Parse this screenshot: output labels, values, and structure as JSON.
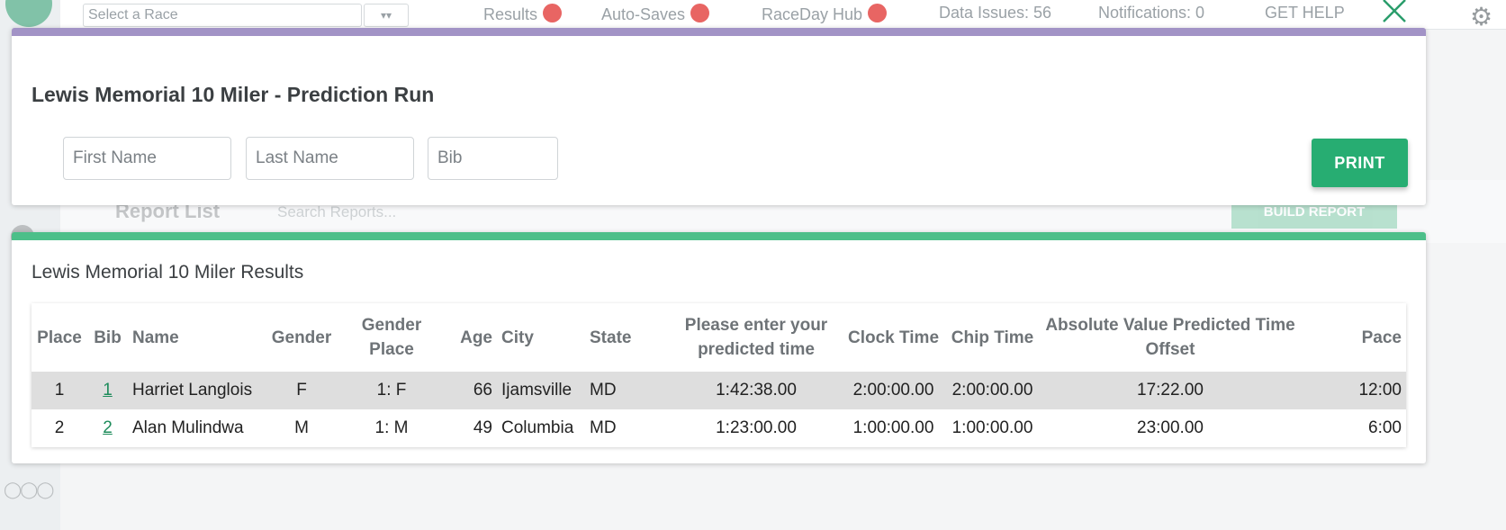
{
  "background": {
    "race_select_placeholder": "Select a Race",
    "nav": [
      {
        "label": "Results",
        "has_dot": true
      },
      {
        "label": "Auto-Saves",
        "has_dot": true
      },
      {
        "label": "RaceDay Hub",
        "has_dot": true
      },
      {
        "label": "Data Issues: 56",
        "has_dot": false
      },
      {
        "label": "Notifications: 0",
        "has_dot": false
      },
      {
        "label": "GET HELP",
        "has_dot": false
      }
    ],
    "report_list_title": "Report List",
    "report_search_placeholder": "Search Reports...",
    "build_report_label": "BUILD REPORT"
  },
  "modal": {
    "close_icon": "close-icon",
    "search_card": {
      "title": "Lewis Memorial 10 Miler - Prediction Run",
      "first_name_placeholder": "First Name",
      "last_name_placeholder": "Last Name",
      "bib_placeholder": "Bib",
      "print_label": "PRINT",
      "accent_color": "#a293c6"
    },
    "results_card": {
      "title": "Lewis Memorial 10 Miler Results",
      "accent_color": "#4cbf89",
      "columns": [
        "Place",
        "Bib",
        "Name",
        "Gender",
        "Gender Place",
        "Age",
        "City",
        "State",
        "Please enter your predicted time",
        "Clock Time",
        "Chip Time",
        "Absolute Value Predicted Time Offset",
        "Pace"
      ],
      "rows": [
        {
          "place": "1",
          "bib": "1",
          "name": "Harriet Langlois",
          "gender": "F",
          "gender_place": "1: F",
          "age": "66",
          "city": "Ijamsville",
          "state": "MD",
          "predicted_time": "1:42:38.00",
          "clock_time": "2:00:00.00",
          "chip_time": "2:00:00.00",
          "offset": "17:22.00",
          "pace": "12:00"
        },
        {
          "place": "2",
          "bib": "2",
          "name": "Alan Mulindwa",
          "gender": "M",
          "gender_place": "1: M",
          "age": "49",
          "city": "Columbia",
          "state": "MD",
          "predicted_time": "1:23:00.00",
          "clock_time": "1:00:00.00",
          "chip_time": "1:00:00.00",
          "offset": "23:00.00",
          "pace": "6:00"
        }
      ]
    }
  },
  "colors": {
    "print_button": "#27ad72",
    "bib_link": "#1e8c5b",
    "row_highlight": "#dedede"
  }
}
